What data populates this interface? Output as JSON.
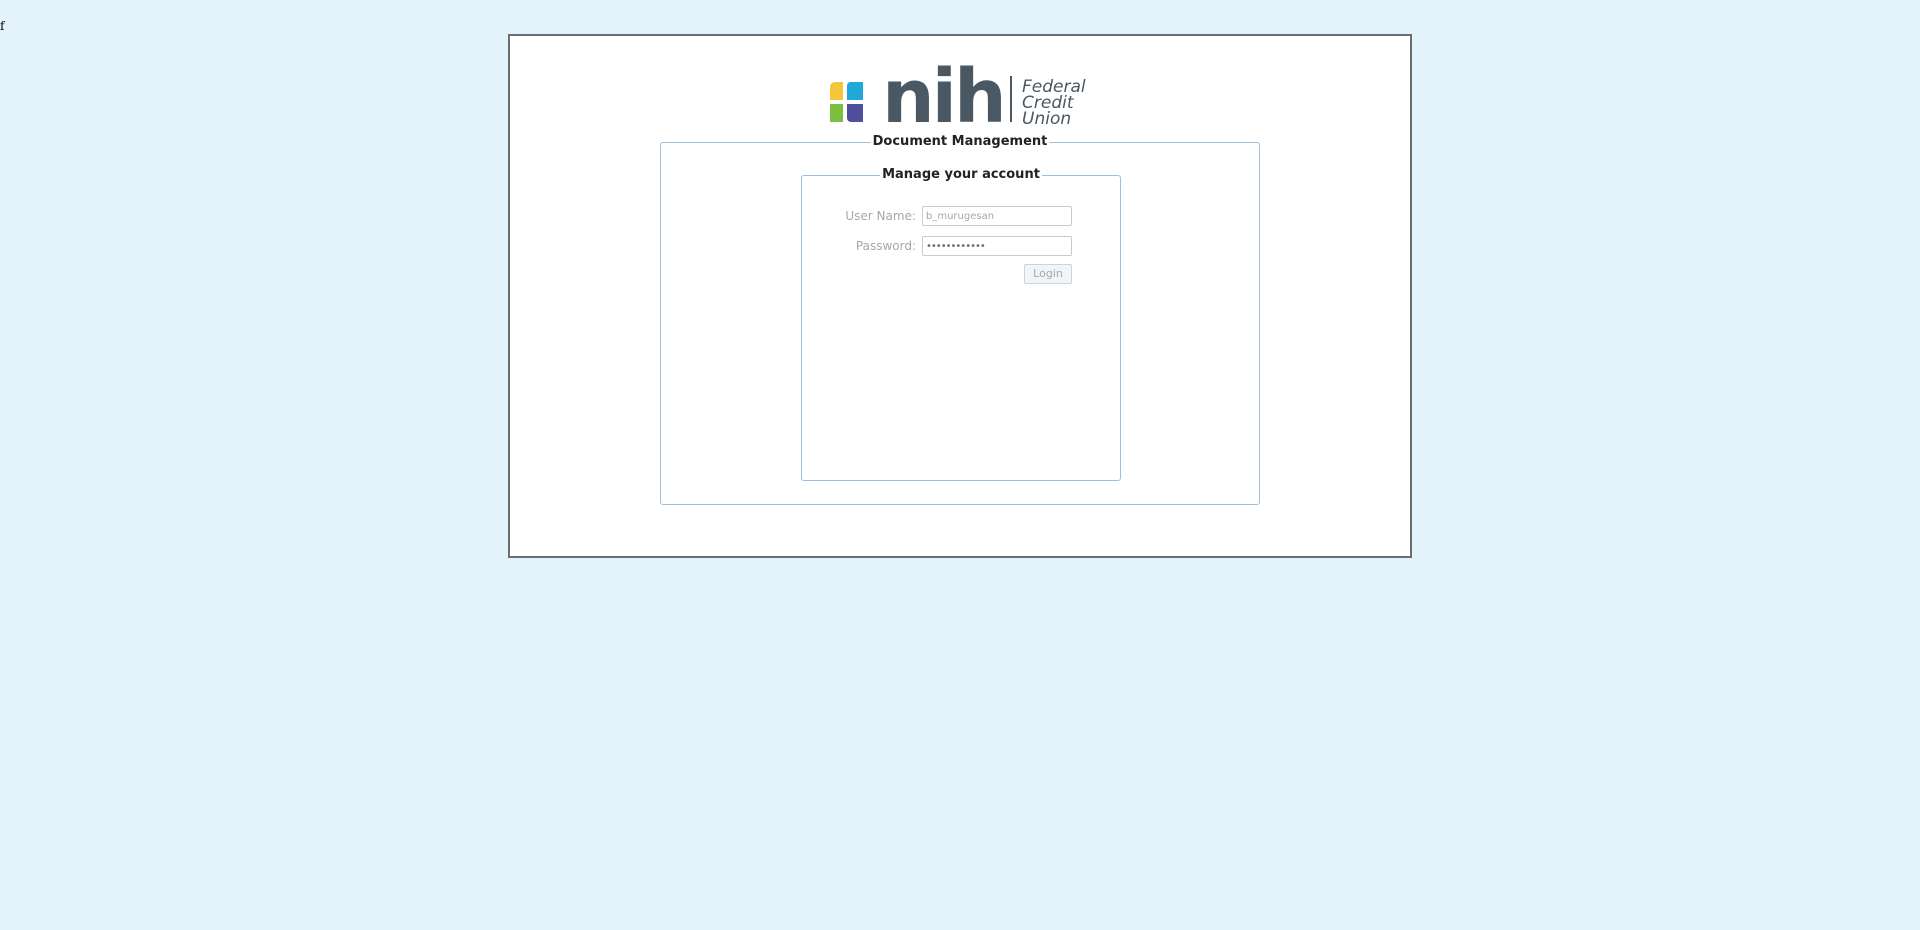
{
  "stray_text": "f",
  "logo": {
    "wordmark": "nih",
    "tagline_line1": "Federal",
    "tagline_line2": "Credit",
    "tagline_line3": "Union",
    "colors": {
      "yellow": "#f5c63c",
      "cyan": "#1fa9d8",
      "green": "#7cbf3f",
      "purple": "#4f4f9e",
      "text": "#4a5863"
    }
  },
  "panel": {
    "title": "Document Management"
  },
  "login_form": {
    "title": "Manage your account",
    "username_label": "User Name:",
    "username_value": "b_murugesan",
    "password_label": "Password:",
    "password_mask": "••••••••••••",
    "login_button": "Login"
  },
  "colors": {
    "page_background": "#e4f3fb",
    "fieldset_border": "#9fbfdb",
    "frame_border": "#6b6f73"
  }
}
